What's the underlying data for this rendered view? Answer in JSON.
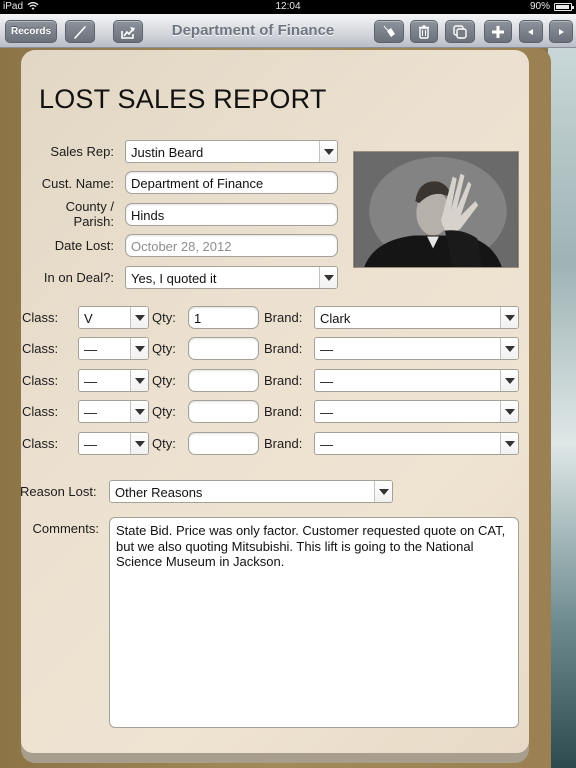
{
  "status_bar": {
    "device": "iPad",
    "time": "12:04",
    "battery": "90%",
    "battery_level": 0.9
  },
  "toolbar": {
    "records_label": "Records",
    "title": "Department of Finance",
    "left_icons": [
      "pen-icon",
      "export-icon"
    ],
    "right_icons": [
      "tag-icon",
      "trash-icon",
      "duplicate-icon",
      "plus-icon",
      "previous-icon",
      "next-icon"
    ]
  },
  "form": {
    "title": "LOST SALES REPORT",
    "sales_rep": {
      "label": "Sales Rep:",
      "value": "Justin Beard"
    },
    "cust_name": {
      "label": "Cust. Name:",
      "value": "Department of Finance"
    },
    "county": {
      "label_line1": "County /",
      "label_line2": "Parish:",
      "value": "Hinds"
    },
    "date_lost": {
      "label": "Date Lost:",
      "value": "October 28, 2012"
    },
    "in_on_deal": {
      "label": "In on Deal?:",
      "value": "Yes, I quoted it"
    },
    "line_items": [
      {
        "class_label": "Class:",
        "class": "V",
        "qty_label": "Qty:",
        "qty": "1",
        "brand_label": "Brand:",
        "brand": "Clark"
      },
      {
        "class_label": "Class:",
        "class": "—",
        "qty_label": "Qty:",
        "qty": "",
        "brand_label": "Brand:",
        "brand": "—"
      },
      {
        "class_label": "Class:",
        "class": "—",
        "qty_label": "Qty:",
        "qty": "",
        "brand_label": "Brand:",
        "brand": "—"
      },
      {
        "class_label": "Class:",
        "class": "—",
        "qty_label": "Qty:",
        "qty": "",
        "brand_label": "Brand:",
        "brand": "—"
      },
      {
        "class_label": "Class:",
        "class": "—",
        "qty_label": "Qty:",
        "qty": "",
        "brand_label": "Brand:",
        "brand": "—"
      }
    ],
    "reason_lost": {
      "label": "Reason Lost:",
      "value": "Other Reasons"
    },
    "comments": {
      "label": "Comments:",
      "value": "State Bid. Price was only factor.  Customer requested quote on CAT, but we also quoting Mitsubishi. This lift is going to the National Science Museum in Jackson."
    }
  }
}
